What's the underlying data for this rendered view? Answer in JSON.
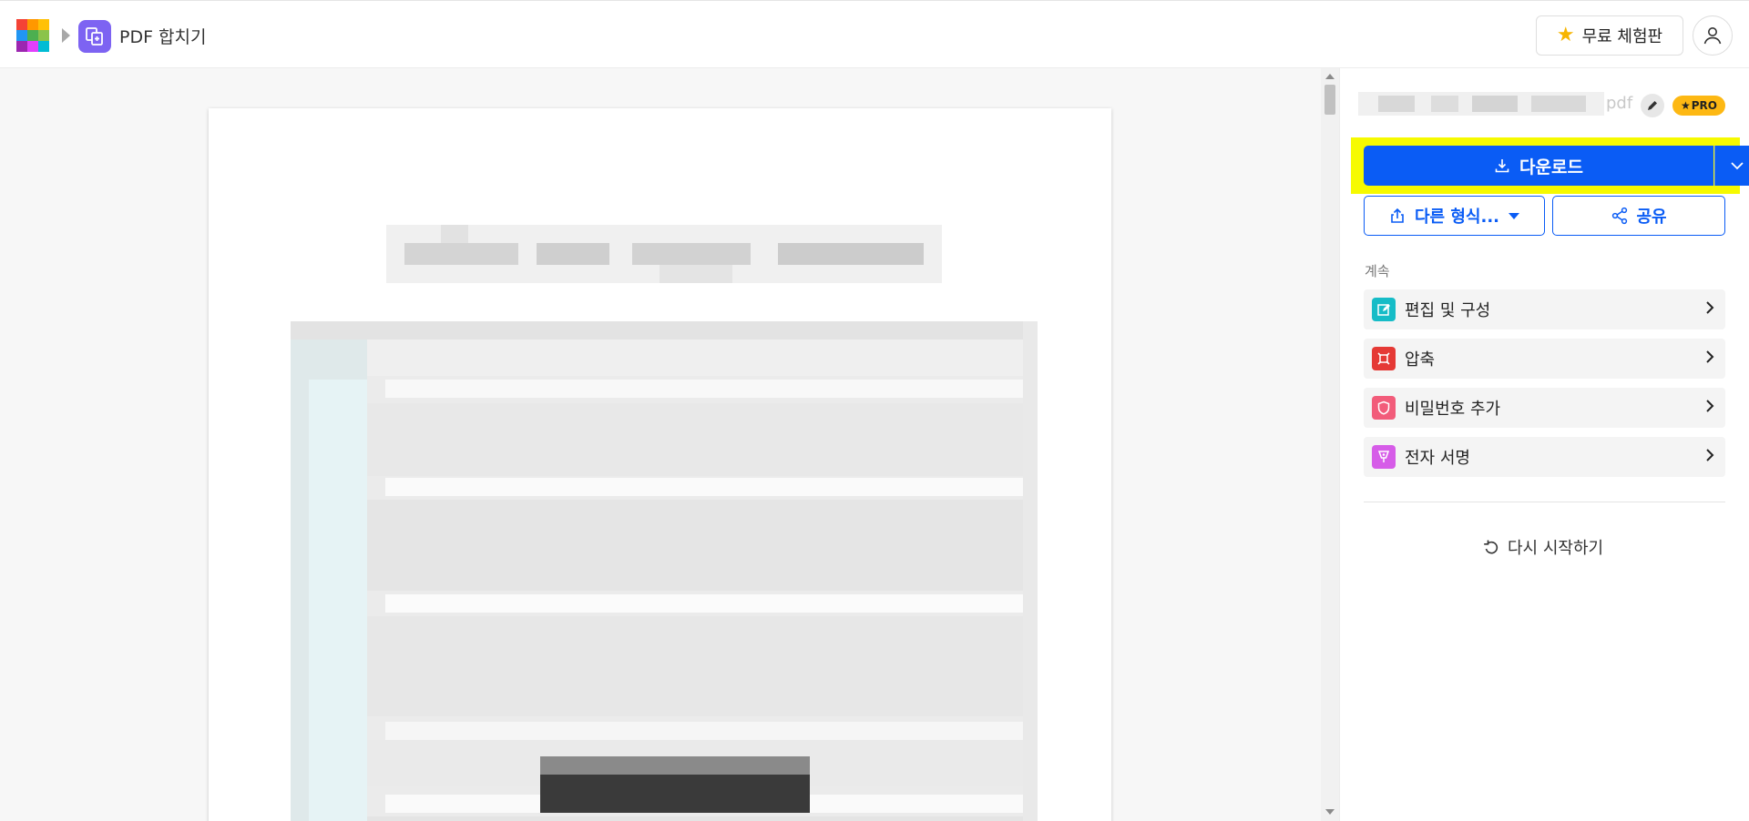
{
  "header": {
    "tool_title": "PDF 합치기",
    "trial_label": "무료 체험판",
    "logo_colors": [
      "#f44336",
      "#ff9800",
      "#ffeb3b",
      "#4caf50",
      "#2196f3",
      "#9c27b0",
      "#e040fb",
      "#00bcd4",
      "#ff5722"
    ],
    "tool_icon_color": "#7d63f2"
  },
  "panel": {
    "file_ext": "pdf",
    "pro_badge": "PRO",
    "download_label": "다운로드",
    "other_format_label": "다른 형식...",
    "share_label": "공유",
    "continue_label": "계속",
    "next_tools": [
      {
        "label": "편집 및 구성",
        "icon": "edit-icon",
        "color": "#16bcc7"
      },
      {
        "label": "압축",
        "icon": "compress-icon",
        "color": "#e53935"
      },
      {
        "label": "비밀번호 추가",
        "icon": "shield-icon",
        "color": "#f25c7a"
      },
      {
        "label": "전자 서명",
        "icon": "pen-icon",
        "color": "#d65ce8"
      }
    ],
    "restart_label": "다시 시작하기",
    "accent_color": "#0a5cf5",
    "highlight_color": "#f6fa00"
  }
}
